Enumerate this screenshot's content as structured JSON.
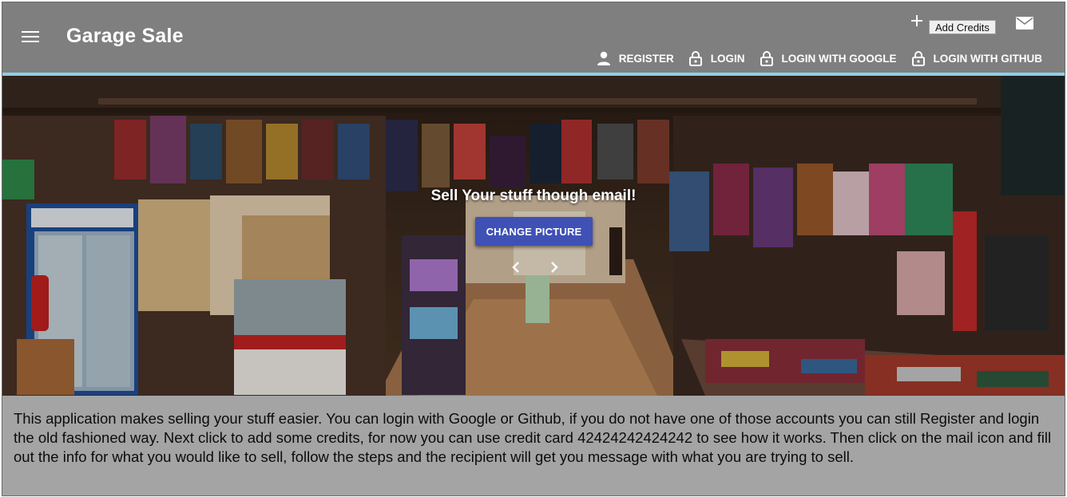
{
  "app": {
    "title": "Garage Sale"
  },
  "header": {
    "menu_icon": "menu-icon",
    "add_credits_label": "Add Credits",
    "plus_icon": "plus-icon",
    "mail_icon": "mail-icon",
    "nav": [
      {
        "label": "REGISTER",
        "icon": "person-icon"
      },
      {
        "label": "LOGIN",
        "icon": "lock-icon"
      },
      {
        "label": "LOGIN WITH GOOGLE",
        "icon": "lock-icon"
      },
      {
        "label": "LOGIN WITH GITHUB",
        "icon": "lock-icon"
      }
    ],
    "accent_color": "#8ecde8"
  },
  "hero": {
    "heading": "Sell Your stuff though email!",
    "button_label": "CHANGE PICTURE",
    "button_color": "#3f51b5"
  },
  "description": {
    "text": "This application makes selling your stuff easier. You can login with Google or Github, if you do not have one of those accounts you can still Register and login the old fashioned way. Next click to add some credits, for now you can use credit card 42424242424242 to see how it works. Then click on the mail icon and fill out the info for what you would like to sell, follow the steps and the recipient will get you message with what you are trying to sell."
  }
}
